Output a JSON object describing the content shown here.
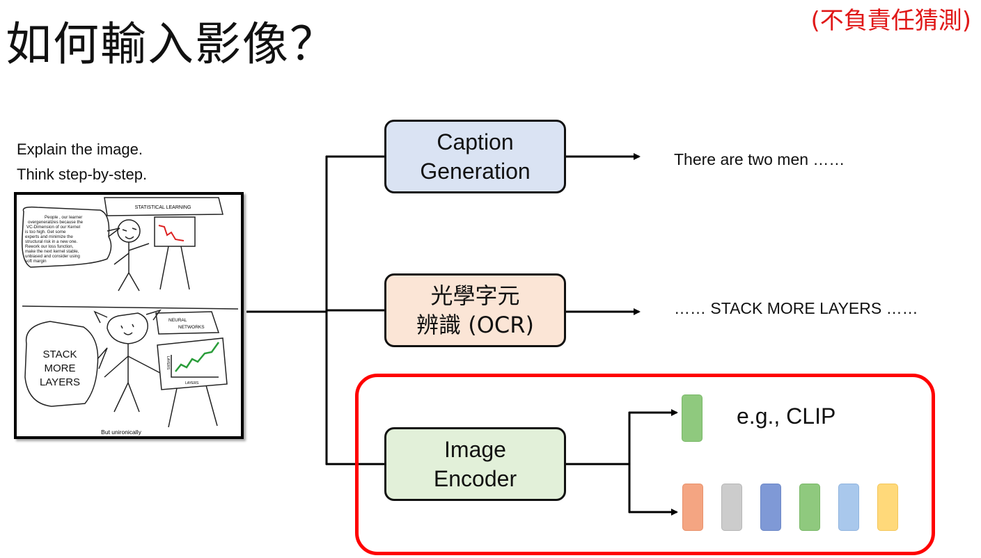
{
  "title": "如何輸入影像？",
  "disclaimer": "(不負責任猜測)",
  "prompt": {
    "line1": "Explain the image.",
    "line2": "Think step-by-step."
  },
  "comic": {
    "top_banner": "STATISTICAL LEARNING",
    "speech_lines": [
      "People , our learner",
      "overgeneralizes because the",
      "VC-Dimension of our Kernel",
      "is too high. Get some",
      "experts and minimize the",
      "structural risk in a new one.",
      "Rework our loss function,",
      "make the next kernel stable,",
      "unbiased and consider using",
      "soft margin"
    ],
    "nn_banner_line1": "NEURAL",
    "nn_banner_line2": "NETWORKS",
    "stack_line1": "STACK",
    "stack_line2": "MORE",
    "stack_line3": "LAYERS",
    "axis_x": "LAYERS",
    "axis_y": "LAYERS",
    "caption": "But unironically"
  },
  "boxes": {
    "caption_line1": "Caption",
    "caption_line2": "Generation",
    "ocr_line1": "光學字元",
    "ocr_line2": "辨識 (OCR)",
    "encoder_line1": "Image",
    "encoder_line2": "Encoder"
  },
  "outputs": {
    "caption": "There are two men ……",
    "ocr": "…… STACK MORE LAYERS ……",
    "clip": "e.g., CLIP"
  },
  "colors": {
    "caption_box": "#dae3f3",
    "ocr_box": "#fbe5d6",
    "encoder_box": "#e2f0d9",
    "highlight": "#ff0000",
    "disclaimer": "#e01818",
    "clip_token": "#8fc97e"
  },
  "tokens": [
    {
      "fill": "#f4a582",
      "stroke": "#e8906a"
    },
    {
      "fill": "#cccccc",
      "stroke": "#b5b5b5"
    },
    {
      "fill": "#7f99d6",
      "stroke": "#6a86c6"
    },
    {
      "fill": "#8fc97e",
      "stroke": "#78b866"
    },
    {
      "fill": "#a9c8ec",
      "stroke": "#8fb3de"
    },
    {
      "fill": "#ffd97a",
      "stroke": "#f3c65a"
    }
  ]
}
